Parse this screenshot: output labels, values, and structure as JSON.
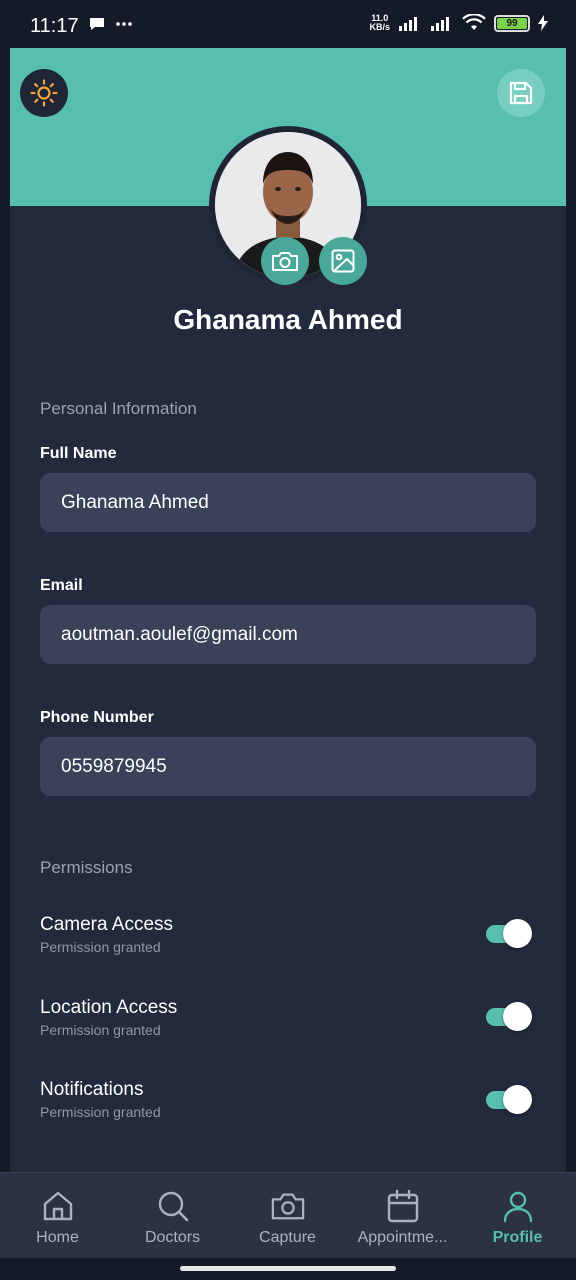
{
  "status_bar": {
    "time": "11:17",
    "net_speed_value": "11.0",
    "net_speed_unit": "KB/s",
    "battery": "99"
  },
  "header": {
    "theme_icon": "sun-icon",
    "save_icon": "save-icon"
  },
  "profile": {
    "name": "Ghanama Ahmed",
    "camera_icon": "camera-icon",
    "gallery_icon": "image-icon"
  },
  "personal_info": {
    "section_title": "Personal Information",
    "full_name_label": "Full Name",
    "full_name_value": "Ghanama Ahmed",
    "email_label": "Email",
    "email_value": "aoutman.aoulef@gmail.com",
    "phone_label": "Phone Number",
    "phone_value": "0559879945"
  },
  "permissions": {
    "section_title": "Permissions",
    "items": [
      {
        "title": "Camera Access",
        "status": "Permission granted",
        "enabled": true
      },
      {
        "title": "Location Access",
        "status": "Permission granted",
        "enabled": true
      },
      {
        "title": "Notifications",
        "status": "Permission granted",
        "enabled": true
      }
    ]
  },
  "bottom_nav": {
    "items": [
      {
        "label": "Home",
        "icon": "home-icon"
      },
      {
        "label": "Doctors",
        "icon": "search-icon"
      },
      {
        "label": "Capture",
        "icon": "camera-icon"
      },
      {
        "label": "Appointme...",
        "icon": "calendar-icon"
      },
      {
        "label": "Profile",
        "icon": "user-icon"
      }
    ],
    "active": "Profile"
  },
  "colors": {
    "accent": "#58bfae",
    "background": "#232a3d",
    "input": "#394258"
  }
}
